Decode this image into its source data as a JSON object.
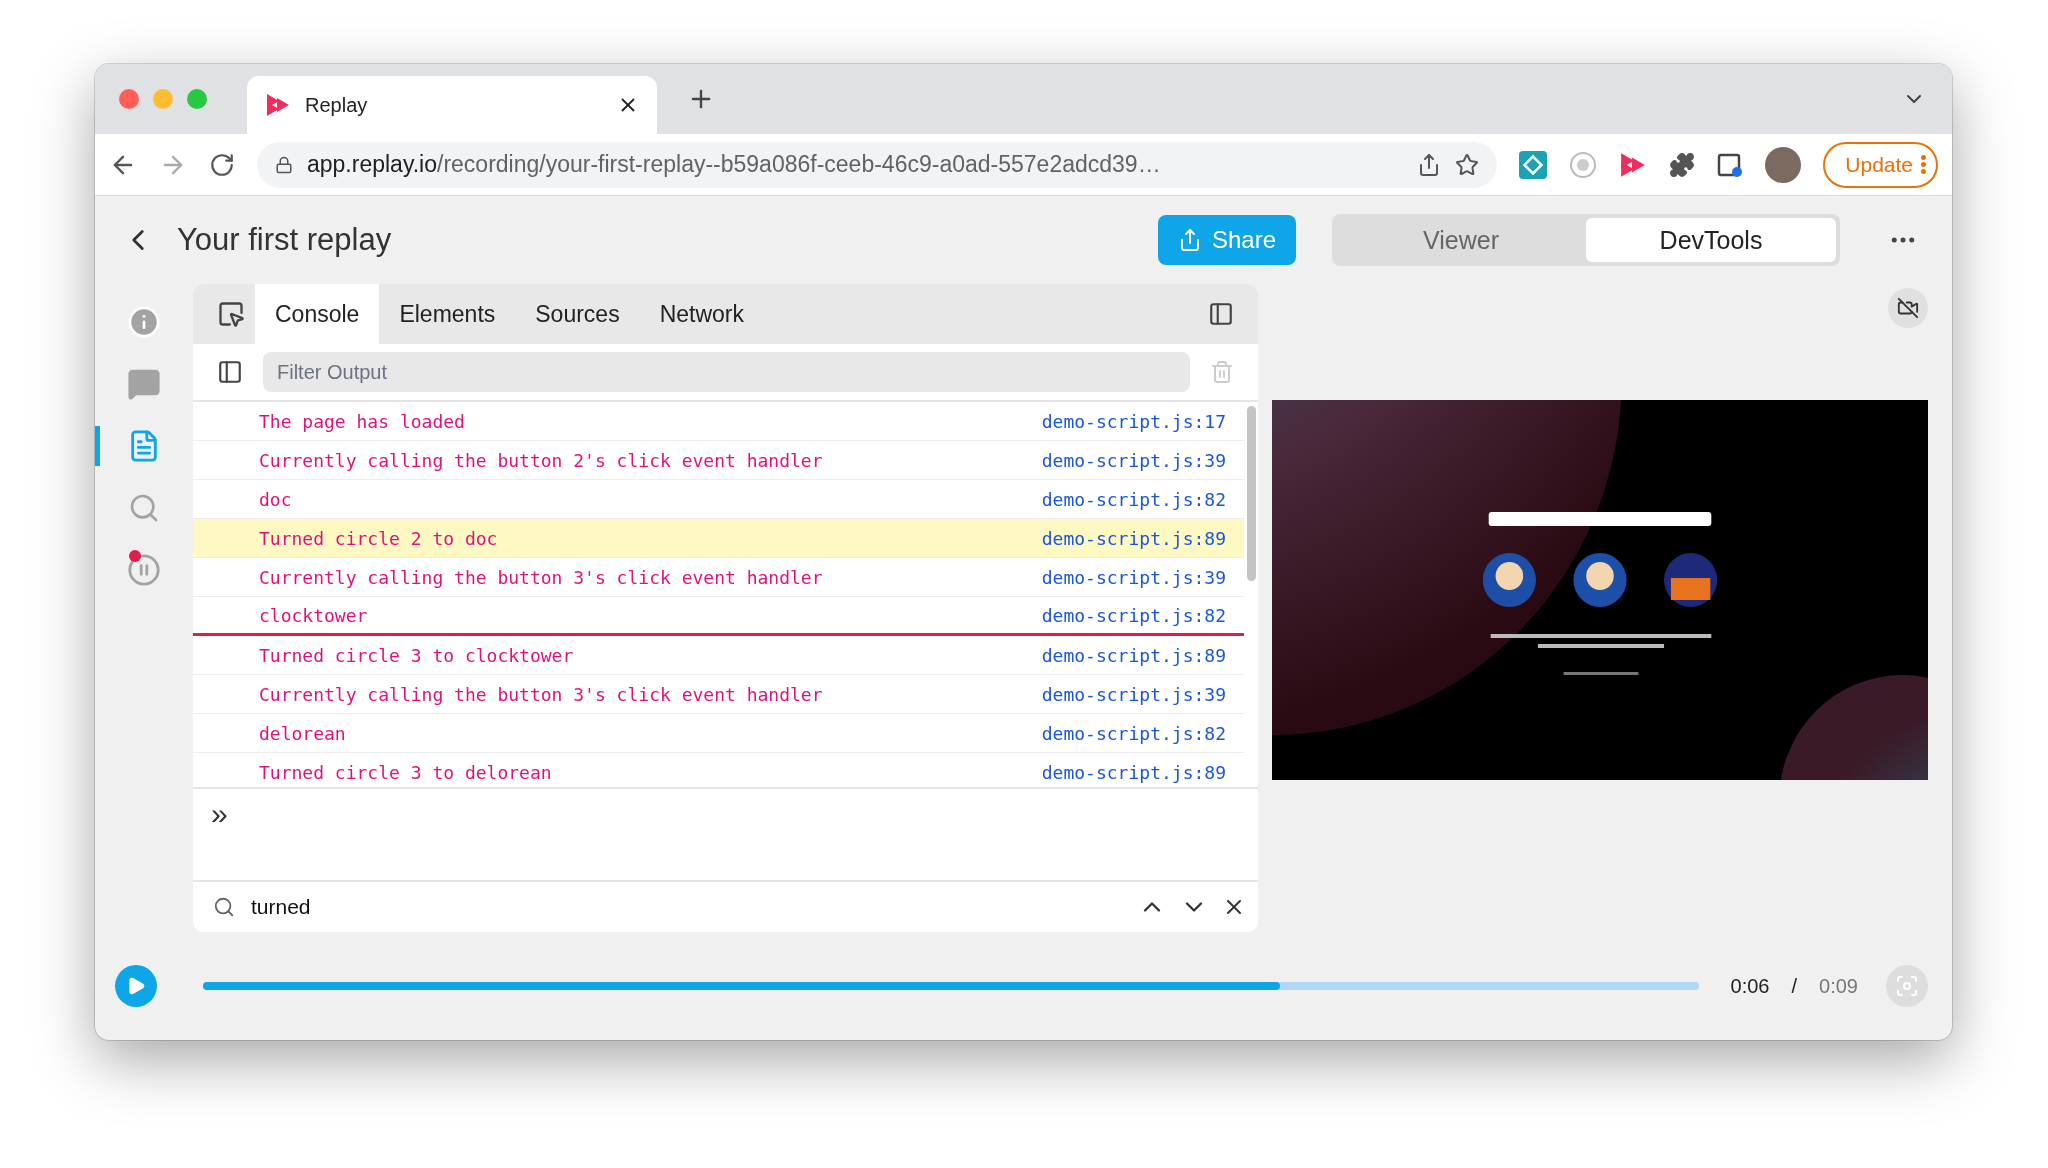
{
  "browser": {
    "tab": {
      "title": "Replay"
    },
    "url": {
      "host": "app.replay.io",
      "path": "/recording/your-first-replay--b59a086f-ceeb-46c9-a0ad-557e2adcd39…"
    },
    "update_button": "Update"
  },
  "header": {
    "title": "Your first replay",
    "share": "Share",
    "modes": [
      {
        "label": "Viewer",
        "selected": false
      },
      {
        "label": "DevTools",
        "selected": true
      }
    ]
  },
  "sidebar": {
    "items": [
      {
        "kind": "info",
        "selected": false
      },
      {
        "kind": "comments",
        "selected": false
      },
      {
        "kind": "events",
        "selected": true
      },
      {
        "kind": "search",
        "selected": false
      },
      {
        "kind": "pause",
        "selected": false,
        "badge": true
      }
    ]
  },
  "devtools": {
    "tabs": [
      {
        "label": "Console",
        "selected": true
      },
      {
        "label": "Elements",
        "selected": false
      },
      {
        "label": "Sources",
        "selected": false
      },
      {
        "label": "Network",
        "selected": false
      }
    ],
    "filter": {
      "placeholder": "Filter Output"
    },
    "messages": [
      {
        "text": "The page has loaded",
        "source": "demo-script.js:17",
        "highlighted": false,
        "paused_below": false
      },
      {
        "text": "Currently calling the button 2's click event handler",
        "source": "demo-script.js:39",
        "highlighted": false,
        "paused_below": false
      },
      {
        "text": "doc",
        "source": "demo-script.js:82",
        "highlighted": false,
        "paused_below": false
      },
      {
        "text": "Turned circle 2 to doc",
        "source": "demo-script.js:89",
        "highlighted": true,
        "paused_below": false
      },
      {
        "text": "Currently calling the button 3's click event handler",
        "source": "demo-script.js:39",
        "highlighted": false,
        "paused_below": false
      },
      {
        "text": "clocktower",
        "source": "demo-script.js:82",
        "highlighted": false,
        "paused_below": true
      },
      {
        "text": "Turned circle 3 to clocktower",
        "source": "demo-script.js:89",
        "highlighted": false,
        "paused_below": false
      },
      {
        "text": "Currently calling the button 3's click event handler",
        "source": "demo-script.js:39",
        "highlighted": false,
        "paused_below": false
      },
      {
        "text": "delorean",
        "source": "demo-script.js:82",
        "highlighted": false,
        "paused_below": false
      },
      {
        "text": "Turned circle 3 to delorean",
        "source": "demo-script.js:89",
        "highlighted": false,
        "paused_below": false
      }
    ],
    "prompt": "»",
    "search": {
      "value": "turned"
    }
  },
  "timeline": {
    "level": 0.72,
    "current": "0:06",
    "separator": "/",
    "total": "0:09"
  }
}
